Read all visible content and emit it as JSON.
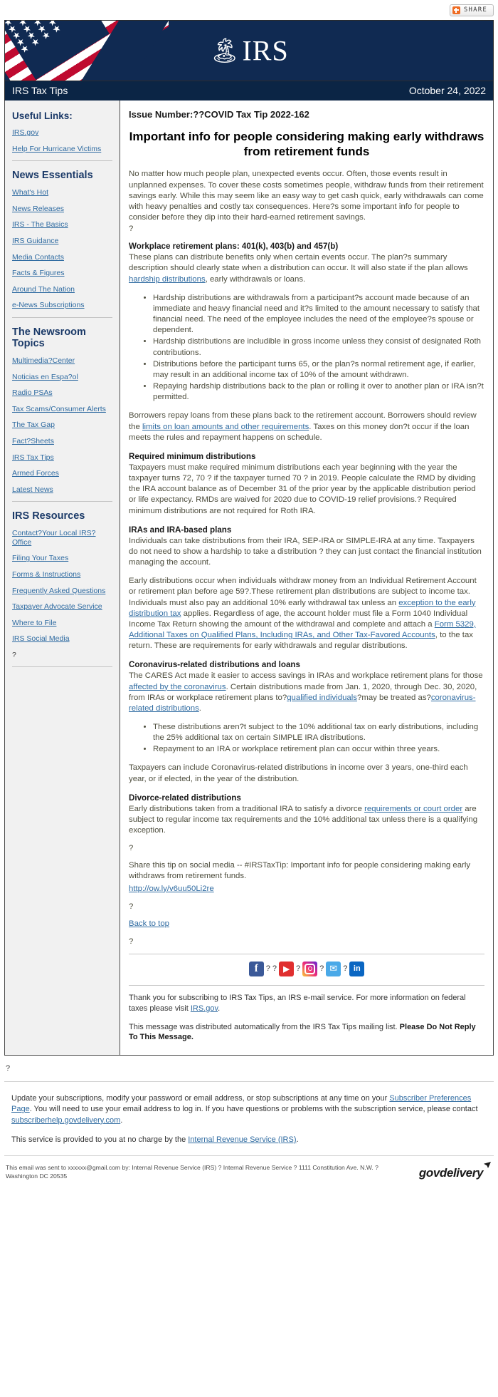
{
  "share": {
    "label": "SHARE",
    "icon": "share-plus-icon"
  },
  "masthead": {
    "logo_text": "IRS",
    "eagle_icon": "irs-eagle-seal-icon",
    "flag_icon": "us-flag-icon"
  },
  "titlebar": {
    "publication": "IRS Tax Tips",
    "date": "October 24, 2022"
  },
  "sidebar": {
    "useful_links_heading": "Useful Links:",
    "useful_links": [
      "IRS.gov",
      "Help For Hurricane Victims"
    ],
    "news_essentials_heading": "News Essentials",
    "news_essentials": [
      "What's Hot",
      "News Releases",
      "IRS - The Basics",
      "IRS Guidance",
      "Media Contacts",
      "Facts & Figures",
      "Around The Nation",
      "e-News Subscriptions"
    ],
    "newsroom_heading": "The Newsroom Topics",
    "newsroom_topics": [
      "Multimedia?Center",
      "Noticias en Espa?ol",
      "Radio PSAs",
      "Tax Scams/Consumer Alerts",
      "The Tax Gap",
      "Fact?Sheets",
      "IRS Tax Tips",
      "Armed Forces",
      "Latest News"
    ],
    "resources_heading": "IRS Resources",
    "resources": [
      "Contact?Your Local IRS?Office",
      "Filing Your Taxes",
      "Forms & Instructions",
      "Frequently Asked Questions",
      "Taxpayer Advocate Service",
      "Where to File",
      "IRS Social Media"
    ],
    "trailing_placeholder": "?"
  },
  "main": {
    "issue_number": "Issue Number:??COVID Tax Tip 2022-162",
    "headline": "Important info for people considering making early withdraws from retirement funds",
    "intro": "No matter how much people plan, unexpected events occur. Often, those events result in unplanned expenses. To cover these costs sometimes people, withdraw funds from their retirement savings early. While this may seem like an easy way to get cash quick, early withdrawals can come with heavy penalties and costly tax consequences. Here?s some important info for people to consider before they dip into their hard-earned retirement savings.",
    "intro_placeholder": "?",
    "workplace": {
      "heading": "Workplace retirement plans: 401(k), 403(b) and 457(b)",
      "body_1": "These plans can distribute benefits only when certain events occur. The plan?s summary description should clearly state when a distribution can occur. It will also state if the plan allows ",
      "link": "hardship distributions",
      "body_2": ", early withdrawals or loans.",
      "bullets": [
        "Hardship distributions are withdrawals from a participant?s account made because of an immediate and heavy financial need and it?s limited to the amount necessary to satisfy that financial need. The need of the employee includes the need of the employee?s spouse or dependent.",
        "Hardship distributions are includible in gross income unless they consist of designated Roth contributions.",
        "Distributions before the participant turns 65, or the plan?s normal retirement age, if earlier, may result in an additional income tax of 10% of the amount withdrawn.",
        "Repaying hardship distributions back to the plan or rolling it over to another plan or IRA isn?t permitted."
      ]
    },
    "borrowers": {
      "body_1": "Borrowers repay loans from these plans back to the retirement account. Borrowers should review the ",
      "link": "limits on loan amounts and other requirements",
      "body_2": ". Taxes on this money don?t occur if the loan meets the rules and repayment happens on schedule."
    },
    "rmd": {
      "heading": "Required minimum distributions",
      "body": "Taxpayers must make required minimum distributions each year beginning with the year the taxpayer turns 72, 70 ? if the taxpayer turned 70 ? in 2019. People calculate the RMD by dividing the IRA account balance as of December 31 of the prior year by the applicable distribution period or life expectancy. RMDs are waived for 2020 due to COVID-19 relief provisions.? Required minimum distributions are not required for Roth IRA."
    },
    "iras": {
      "heading": "IRAs and IRA-based plans",
      "body": "Individuals can take distributions from their IRA, SEP-IRA or SIMPLE-IRA at any time. Taxpayers do not need to show a hardship to take a distribution ? they can just contact the financial institution managing the account."
    },
    "early_dist": {
      "body_1": "Early distributions occur when individuals withdraw money from an Individual Retirement Account or retirement plan before age 59?.These retirement plan distributions are subject to income tax. Individuals must also pay an additional 10% early withdrawal tax unless an ",
      "link_1": "exception to the early distribution tax",
      "body_2": " applies. Regardless of age, the account holder must file a Form 1040 Individual Income Tax Return showing the amount of the withdrawal and complete and attach a ",
      "link_2": "Form 5329, Additional Taxes on Qualified Plans, Including IRAs, and Other Tax-Favored Accounts",
      "body_3": ", to the tax return. These are requirements for early withdrawals and regular distributions."
    },
    "corona": {
      "heading": "Coronavirus-related distributions and loans",
      "body_1": "The CARES Act made it easier to access savings in IRAs and workplace retirement plans for those ",
      "link_1": "affected by the coronavirus",
      "body_2": ". Certain distributions made from Jan. 1, 2020, through Dec. 30, 2020, from IRAs or workplace retirement plans to?",
      "link_2": "qualified individuals",
      "body_3": "?may be treated as?",
      "link_3": "coronavirus-related distributions",
      "body_4": ".",
      "bullets": [
        "These distributions aren?t subject to the 10% additional tax on early distributions, including the 25% additional tax on certain SIMPLE IRA distributions.",
        "Repayment to an IRA or workplace retirement plan can occur within three years."
      ],
      "closing": "Taxpayers can include Coronavirus-related distributions in income over 3 years, one-third each year, or if elected, in the year of the distribution."
    },
    "divorce": {
      "heading": "Divorce-related distributions",
      "body_1": "Early distributions taken from a traditional IRA to satisfy a divorce ",
      "link": "requirements or court order",
      "body_2": " are subject to regular income tax requirements and the 10% additional tax unless there is a qualifying exception."
    },
    "placeholder_1": "?",
    "share_tip": "Share this tip on social media -- #IRSTaxTip: Important info for people considering making early withdraws from retirement funds.",
    "share_url": "http://ow.ly/v6uu50Li2re",
    "placeholder_2": "?",
    "back_to_top": "Back to top",
    "placeholder_3": "?",
    "social": [
      {
        "name": "facebook-icon",
        "glyph": "f",
        "cls": "fb"
      },
      {
        "name": "youtube-icon",
        "glyph": "▶",
        "cls": "yt"
      },
      {
        "name": "instagram-icon",
        "glyph": "",
        "cls": "ig"
      },
      {
        "name": "twitter-icon",
        "glyph": "✉",
        "cls": "tw"
      },
      {
        "name": "linkedin-icon",
        "glyph": "in",
        "cls": "li"
      }
    ],
    "social_sep": "?",
    "thanks_1": "Thank you for subscribing to IRS Tax Tips, an IRS e-mail service. For more information on federal taxes please visit ",
    "thanks_link": "IRS.gov",
    "thanks_1b": ".",
    "thanks_2": "This message was distributed automatically from the IRS Tax Tips mailing list. ",
    "thanks_2_bold": "Please Do Not Reply To This Message."
  },
  "footer": {
    "below_placeholder": "?",
    "update_1": "Update your subscriptions, modify your password or email address, or stop subscriptions at any time on your ",
    "update_link": "Subscriber Preferences Page",
    "update_2": ". You will need to use your email address to log in. If you have questions or problems with the subscription service, please contact ",
    "update_link_2": "subscriberhelp.govdelivery.com",
    "update_3": ".",
    "free_1": "This service is provided to you at no charge by the ",
    "free_link": "Internal Revenue Service (IRS)",
    "free_2": ".",
    "sent_to": "This email was sent to xxxxxx@gmail.com by: Internal Revenue Service (IRS) ? Internal Revenue Service ? 1111 Constitution Ave. N.W. ? Washington DC 20535",
    "govdelivery": "govdelivery"
  }
}
